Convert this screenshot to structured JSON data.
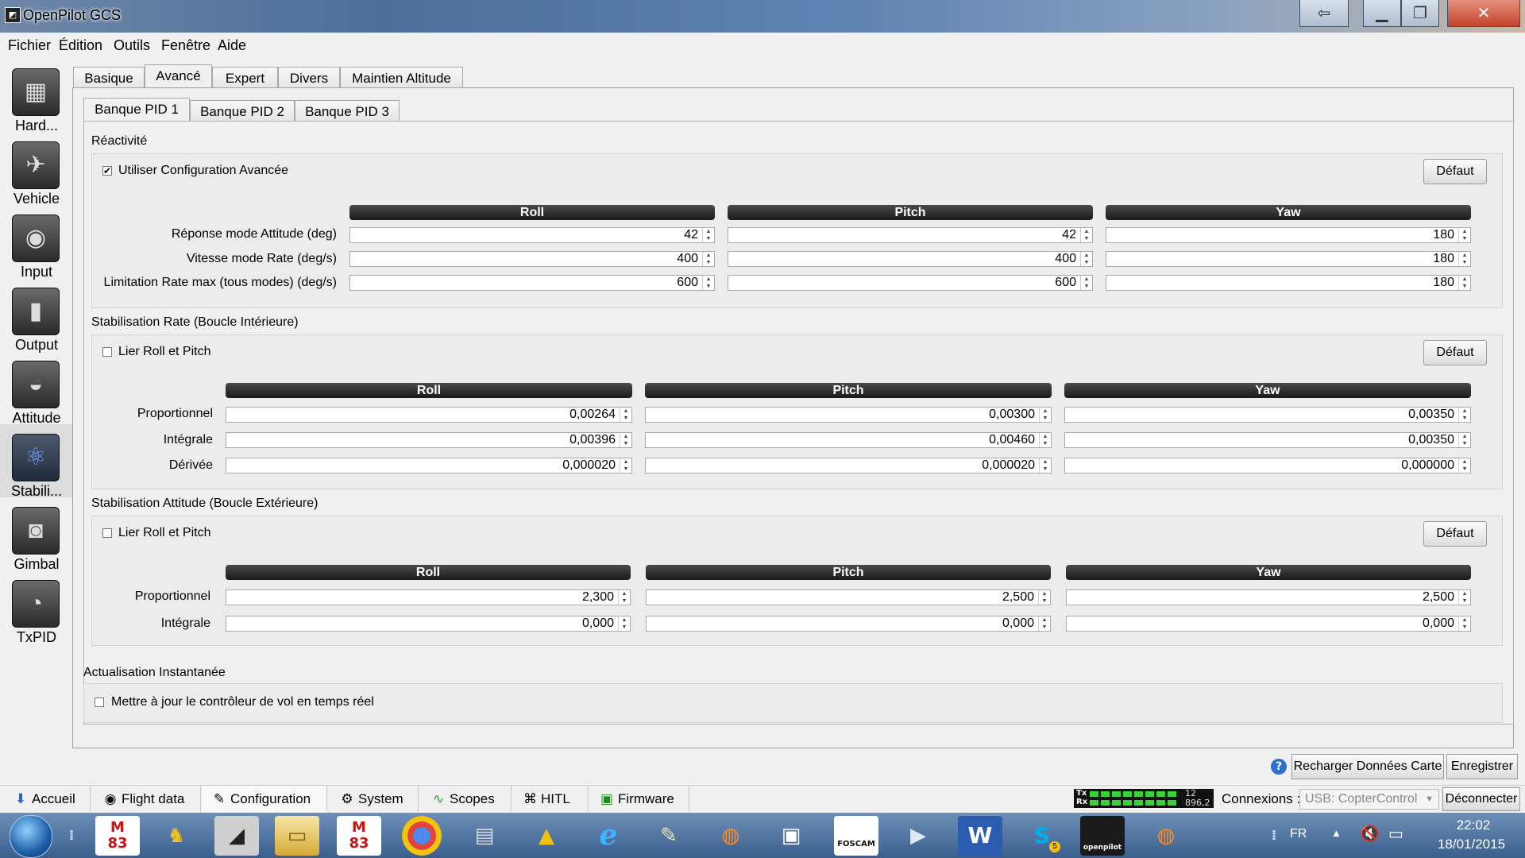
{
  "window": {
    "title": "OpenPilot GCS"
  },
  "menu": [
    "Fichier",
    "Édition",
    "Outils",
    "Fenêtre",
    "Aide"
  ],
  "sidebar": [
    {
      "label": "Hard...",
      "icon": "chip-icon"
    },
    {
      "label": "Vehicle",
      "icon": "aircraft-icon"
    },
    {
      "label": "Input",
      "icon": "transmitter-icon"
    },
    {
      "label": "Output",
      "icon": "motor-icon"
    },
    {
      "label": "Attitude",
      "icon": "horizon-icon"
    },
    {
      "label": "Stabili...",
      "icon": "gyro-icon"
    },
    {
      "label": "Gimbal",
      "icon": "camera-icon"
    },
    {
      "label": "TxPID",
      "icon": "gauge-icon"
    }
  ],
  "tabs": [
    "Basique",
    "Avancé",
    "Expert",
    "Divers",
    "Maintien Altitude"
  ],
  "subtabs": [
    "Banque PID 1",
    "Banque PID 2",
    "Banque PID 3"
  ],
  "reactivity": {
    "title": "Réactivité",
    "checkbox_label": "Utiliser Configuration Avancée",
    "checked": true,
    "default_btn": "Défaut",
    "cols": [
      "Roll",
      "Pitch",
      "Yaw"
    ],
    "rows": [
      {
        "label": "Réponse mode Attitude (deg)",
        "values": [
          "42",
          "42",
          "180"
        ]
      },
      {
        "label": "Vitesse mode Rate (deg/s)",
        "values": [
          "400",
          "400",
          "180"
        ]
      },
      {
        "label": "Limitation Rate max (tous modes) (deg/s)",
        "values": [
          "600",
          "600",
          "180"
        ]
      }
    ]
  },
  "rate_loop": {
    "title": "Stabilisation Rate (Boucle Intérieure)",
    "checkbox_label": "Lier Roll et Pitch",
    "checked": false,
    "default_btn": "Défaut",
    "cols": [
      "Roll",
      "Pitch",
      "Yaw"
    ],
    "rows": [
      {
        "label": "Proportionnel",
        "values": [
          "0,00264",
          "0,00300",
          "0,00350"
        ]
      },
      {
        "label": "Intégrale",
        "values": [
          "0,00396",
          "0,00460",
          "0,00350"
        ]
      },
      {
        "label": "Dérivée",
        "values": [
          "0,000020",
          "0,000020",
          "0,000000"
        ]
      }
    ]
  },
  "attitude_loop": {
    "title": "Stabilisation Attitude (Boucle Extérieure)",
    "checkbox_label": "Lier Roll et Pitch",
    "checked": false,
    "default_btn": "Défaut",
    "cols": [
      "Roll",
      "Pitch",
      "Yaw"
    ],
    "rows": [
      {
        "label": "Proportionnel",
        "values": [
          "2,300",
          "2,500",
          "2,500"
        ]
      },
      {
        "label": "Intégrale",
        "values": [
          "0,000",
          "0,000",
          "0,000"
        ]
      }
    ]
  },
  "realtime": {
    "title": "Actualisation Instantanée",
    "checkbox_label": "Mettre à jour le contrôleur de vol en temps réel",
    "checked": false
  },
  "actions": {
    "help": "?",
    "reload": "Recharger Données Carte",
    "save": "Enregistrer"
  },
  "modes": [
    "Accueil",
    "Flight data",
    "Configuration",
    "System",
    "Scopes",
    "HITL",
    "Firmware"
  ],
  "status": {
    "tx_label": "Tx",
    "rx_label": "Rx",
    "rate_top": "12",
    "rate_bottom": "896,2",
    "connections_label": "Connexions :",
    "connection_value": "USB: CopterControl",
    "disconnect": "Déconnecter"
  },
  "taskbar": {
    "lang": "FR",
    "time": "22:02",
    "date": "18/01/2015",
    "badge_m": "M",
    "badge_83": "83",
    "skype_count": "5",
    "foscam": "FOSCAM",
    "openpilot": "openpilot"
  }
}
